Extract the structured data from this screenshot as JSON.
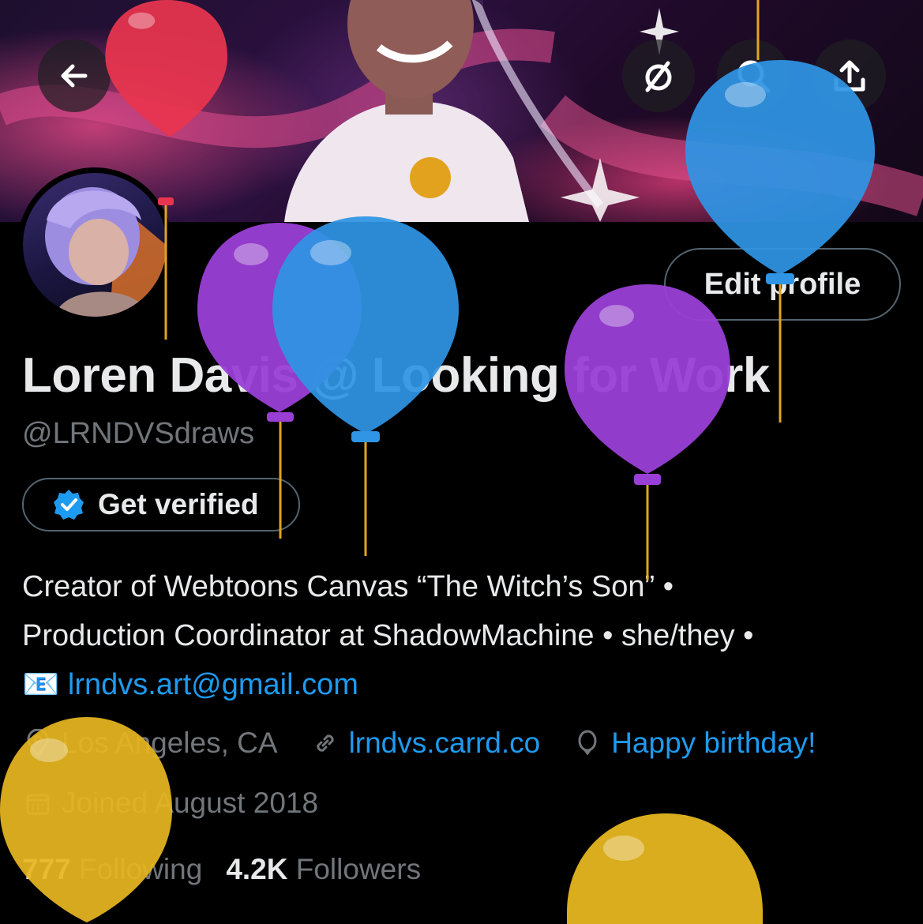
{
  "header": {
    "back_icon": "arrow-left-icon",
    "hide_icon": "eye-slash-icon",
    "search_icon": "search-icon",
    "share_icon": "share-upload-icon"
  },
  "profile": {
    "display_name": "Loren Davis @ Looking for Work",
    "handle": "@LRNDVSdraws",
    "edit_button": "Edit profile",
    "get_verified": "Get verified",
    "bio_line1": "Creator of Webtoons Canvas “The Witch’s Son” •",
    "bio_line2": "Production Coordinator at ShadowMachine • she/they •",
    "bio_email_emoji": "📧",
    "bio_email": "lrndvs.art@gmail.com",
    "location": "Los Angeles, CA",
    "website": "lrndvs.carrd.co",
    "birthday": "Happy birthday!",
    "joined": "Joined August 2018",
    "following_count": "777",
    "following_label": "Following",
    "followers_count": "4.2K",
    "followers_label": "Followers"
  },
  "colors": {
    "background": "#000000",
    "text": "#e7e9ea",
    "secondary": "#71767b",
    "link": "#1d9bf0",
    "border": "#536471",
    "balloon_red": "#e8354f",
    "balloon_blue": "#2f95e4",
    "balloon_purple": "#9a3fd6",
    "balloon_yellow": "#e6b620"
  }
}
